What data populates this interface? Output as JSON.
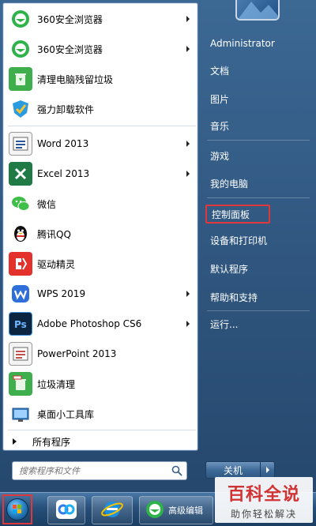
{
  "start_menu": {
    "programs": [
      {
        "label": "360安全浏览器",
        "icon": "360-browser-icon",
        "has_submenu": true
      },
      {
        "label": "360安全浏览器",
        "icon": "360-browser-icon",
        "has_submenu": true
      },
      {
        "label": "清理电脑残留垃圾",
        "icon": "recycle-bin-icon",
        "has_submenu": false
      },
      {
        "label": "强力卸载软件",
        "icon": "uninstall-shield-icon",
        "has_submenu": false
      },
      {
        "label": "Word 2013",
        "icon": "word-icon",
        "has_submenu": true
      },
      {
        "label": "Excel 2013",
        "icon": "excel-icon",
        "has_submenu": true
      },
      {
        "label": "微信",
        "icon": "wechat-icon",
        "has_submenu": false
      },
      {
        "label": "腾讯QQ",
        "icon": "qq-penguin-icon",
        "has_submenu": false
      },
      {
        "label": "驱动精灵",
        "icon": "driver-genius-icon",
        "has_submenu": false
      },
      {
        "label": "WPS 2019",
        "icon": "wps-icon",
        "has_submenu": true
      },
      {
        "label": "Adobe Photoshop CS6",
        "icon": "photoshop-icon",
        "has_submenu": true
      },
      {
        "label": "PowerPoint 2013",
        "icon": "powerpoint-icon",
        "has_submenu": false
      },
      {
        "label": "垃圾清理",
        "icon": "trash-cleaner-icon",
        "has_submenu": false
      },
      {
        "label": "桌面小工具库",
        "icon": "gadgets-icon",
        "has_submenu": false
      }
    ],
    "all_programs": "所有程序",
    "search_placeholder": "搜索程序和文件",
    "right_items": [
      "Administrator",
      "文档",
      "图片",
      "音乐",
      "游戏",
      "我的电脑",
      "控制面板",
      "设备和打印机",
      "默认程序",
      "帮助和支持",
      "运行..."
    ],
    "shutdown_label": "关机"
  },
  "taskbar": {
    "app_label": "高级编辑"
  },
  "watermark": {
    "title": "百科全说",
    "subtitle": "助你轻松解决"
  },
  "colors": {
    "highlight": "#e0383a",
    "menu_blue": "#2e5884"
  }
}
